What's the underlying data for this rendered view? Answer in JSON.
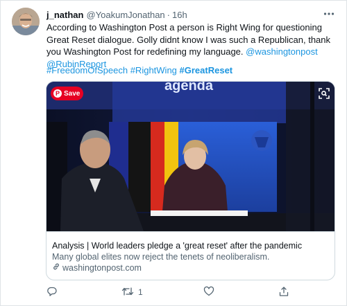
{
  "tweet": {
    "display_name": "j_nathan",
    "handle": "@YoakumJonathan",
    "separator": "·",
    "time": "16h",
    "text_plain": "According to Washington Post a person is Right Wing for questioning Great Reset dialogue. Golly didnt know I was such a Republican, thank you Washington Post for redefining my language.",
    "mention_1": "@washingtonpost",
    "mention_2": "@RubinReport",
    "hashtag_1": "#FreedomOfSpeech",
    "hashtag_2": "#RightWing",
    "hashtag_3": "#GreatReset"
  },
  "card": {
    "save_label": "Save",
    "image_banner": "agenda",
    "title": "Analysis | World leaders pledge a 'great reset' after the pandemic",
    "description": "Many global elites now reject the tenets of neoliberalism.",
    "domain": "washingtonpost.com"
  },
  "actions": {
    "retweet_count": "1"
  },
  "icons": {
    "more": "more-horizontal-icon",
    "reply": "reply-icon",
    "retweet": "retweet-icon",
    "like": "like-icon",
    "share": "share-icon",
    "link": "link-icon",
    "pin": "pinterest-icon",
    "lens": "visual-search-icon"
  },
  "colors": {
    "link": "#1b95e0",
    "secondary_text": "#536471",
    "pinterest_red": "#e60023"
  }
}
